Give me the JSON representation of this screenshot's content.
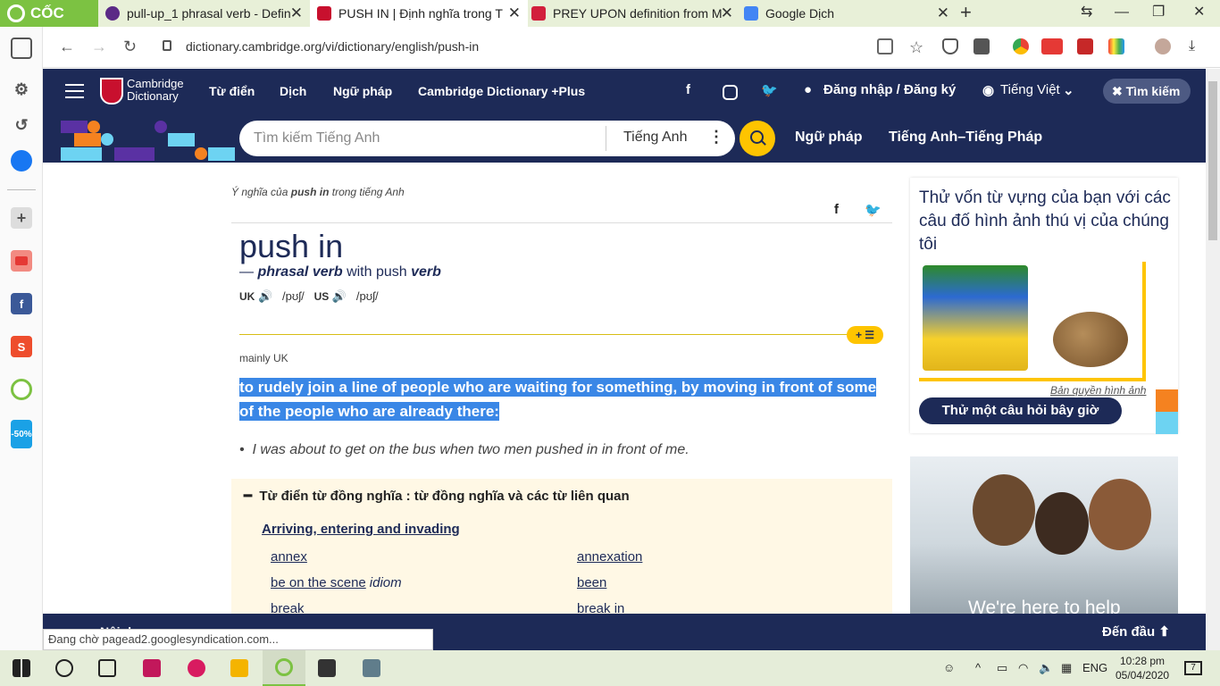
{
  "browser": {
    "brand": "CỐC CỐC",
    "tabs": [
      {
        "title": "pull-up_1 phrasal verb - Defin",
        "color": "#5b2a86"
      },
      {
        "title": "PUSH IN | Định nghĩa trong T",
        "color": "#c8102e"
      },
      {
        "title": "PREY UPON definition from M",
        "color": "#d21f3c"
      },
      {
        "title": "Google Dịch",
        "color": "#4285f4"
      }
    ],
    "url": "dictionary.cambridge.org/vi/dictionary/english/push-in",
    "status": "Đang chờ pagead2.googlesyndication.com..."
  },
  "header": {
    "logo_line1": "Cambridge",
    "logo_line2": "Dictionary",
    "nav": [
      "Từ điển",
      "Dịch",
      "Ngữ pháp",
      "Cambridge Dictionary +Plus"
    ],
    "login": "Đăng nhập / Đăng ký",
    "language": "Tiếng Việt",
    "search_toggle": "Tìm kiếm"
  },
  "searchbar": {
    "placeholder": "Tìm kiếm Tiếng Anh",
    "dictionary": "Tiếng Anh",
    "links": [
      "Ngữ pháp",
      "Tiếng Anh–Tiếng Pháp"
    ]
  },
  "entry": {
    "crumb_prefix": "Ý nghĩa của",
    "crumb_word": "push in",
    "crumb_suffix": "trong tiếng Anh",
    "headword": "push in",
    "pos_dash": "—",
    "pos_main": "phrasal verb",
    "pos_with": "with push",
    "pos_verb": "verb",
    "uk_label": "UK",
    "uk_pron": "/pʊʃ/",
    "us_label": "US",
    "us_pron": "/pʊʃ/",
    "usage": "mainly UK",
    "definition": "to rudely join a line of people who are waiting for something, by moving in front of some of the people who are already there:",
    "example": "I was about to get on the bus when two men pushed in in front of me.",
    "list_badge": "+ ☰"
  },
  "thesaurus": {
    "title": "Từ điển từ đồng nghĩa : từ đồng nghĩa và các từ liên quan",
    "category": "Arriving, entering and invading",
    "words": [
      {
        "word": "annex",
        "suffix": ""
      },
      {
        "word": "annexation",
        "suffix": ""
      },
      {
        "word": "be on the scene",
        "suffix": "idiom"
      },
      {
        "word": "been",
        "suffix": ""
      },
      {
        "word": "break",
        "suffix": ""
      },
      {
        "word": "break in",
        "suffix": ""
      }
    ]
  },
  "quiz": {
    "title": "Thử vốn từ vựng của bạn với các câu đố hình ảnh thú vị của chúng tôi",
    "credit": "Bản quyền hình ảnh",
    "button": "Thử một câu hỏi bây giờ"
  },
  "ad": {
    "text": "We're here to help"
  },
  "footer": {
    "to_top": "Đến đầu",
    "partial": "Nội d"
  },
  "taskbar": {
    "lang": "ENG",
    "time": "10:28 pm",
    "date": "05/04/2020",
    "notifications": "7"
  },
  "colors": {
    "navy": "#1d2a57",
    "accent": "#fec400",
    "highlight": "#3a87e6",
    "coccoc": "#7cc242"
  }
}
